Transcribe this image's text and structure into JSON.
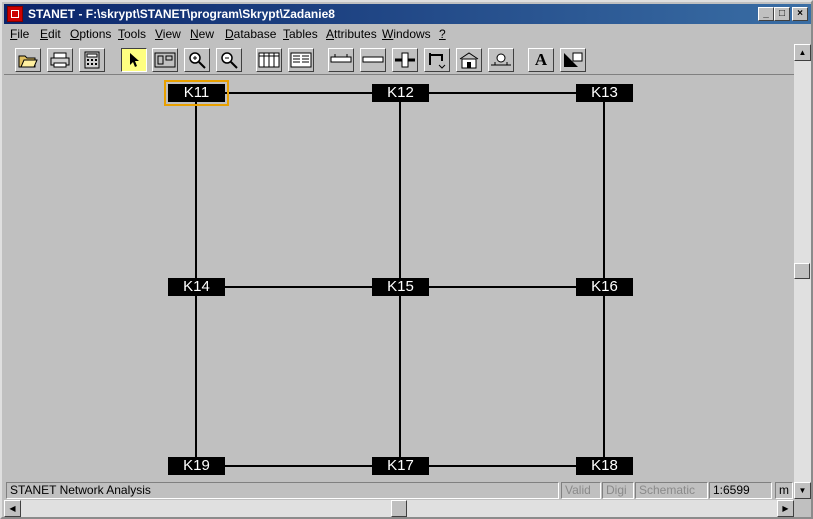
{
  "window": {
    "title": "STANET - F:\\skrypt\\STANET\\program\\Skrypt\\Zadanie8"
  },
  "menu": [
    "File",
    "Edit",
    "Options",
    "Tools",
    "View",
    "New",
    "Database",
    "Tables",
    "Attributes",
    "Windows",
    "?"
  ],
  "toolbar": {
    "tools": [
      "open-icon",
      "print-icon",
      "calculator-icon",
      "select-arrow-icon",
      "map-icon",
      "zoom-in-icon",
      "zoom-out-icon",
      "table-icon",
      "form-icon",
      "pipe-icon",
      "segment-icon",
      "valve-icon",
      "tap-icon",
      "building-icon",
      "pump-icon",
      "text-tool-icon",
      "fill-tool-icon"
    ],
    "text_tool_label": "A",
    "active_tool": "select-arrow-icon"
  },
  "network": {
    "nodes": [
      {
        "id": "K11",
        "label": "K11",
        "selected": true
      },
      {
        "id": "K12",
        "label": "K12"
      },
      {
        "id": "K13",
        "label": "K13"
      },
      {
        "id": "K14",
        "label": "K14"
      },
      {
        "id": "K15",
        "label": "K15"
      },
      {
        "id": "K16",
        "label": "K16"
      },
      {
        "id": "K19",
        "label": "K19"
      },
      {
        "id": "K17",
        "label": "K17"
      },
      {
        "id": "K18",
        "label": "K18"
      }
    ],
    "edges": [
      [
        "K11",
        "K12"
      ],
      [
        "K12",
        "K13"
      ],
      [
        "K14",
        "K15"
      ],
      [
        "K15",
        "K16"
      ],
      [
        "K19",
        "K17"
      ],
      [
        "K17",
        "K18"
      ],
      [
        "K11",
        "K14"
      ],
      [
        "K14",
        "K19"
      ],
      [
        "K12",
        "K15"
      ],
      [
        "K15",
        "K17"
      ],
      [
        "K13",
        "K16"
      ],
      [
        "K16",
        "K18"
      ]
    ],
    "colors": {
      "node_bg": "#000000",
      "node_text": "#ffffff",
      "edge": "#000000",
      "selection": "#e8a000",
      "canvas": "#c0c0c0"
    }
  },
  "status": {
    "message": "STANET Network Analysis",
    "valid": "Valid",
    "digi": "Digi",
    "mode": "Schematic",
    "scale": "1:6599",
    "unit": "m"
  }
}
